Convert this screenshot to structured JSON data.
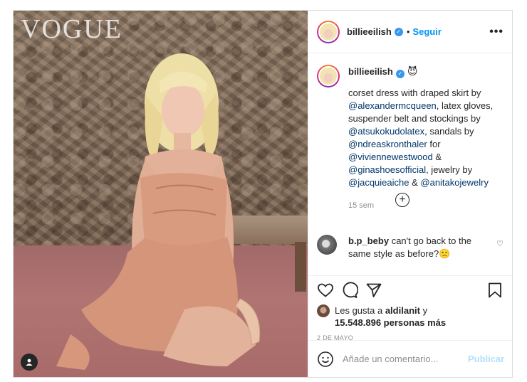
{
  "photo": {
    "masthead": "VOGUE"
  },
  "post": {
    "username": "billieeilish",
    "follow_label": "Seguir",
    "more_label": "•••",
    "caption_emoji": "😈",
    "caption": [
      {
        "t": "corset dress with draped skirt by ",
        "m": false
      },
      {
        "t": "@alexandermcqueen",
        "m": true
      },
      {
        "t": ", latex gloves, suspender belt and stockings by ",
        "m": false
      },
      {
        "t": "@atsukokudolatex",
        "m": true
      },
      {
        "t": ", sandals by ",
        "m": false
      },
      {
        "t": "@ndreaskronthaler",
        "m": true
      },
      {
        "t": " for ",
        "m": false
      },
      {
        "t": "@viviennewestwood",
        "m": true
      },
      {
        "t": " & ",
        "m": false
      },
      {
        "t": "@ginashoesofficial",
        "m": true
      },
      {
        "t": ", jewelry by ",
        "m": false
      },
      {
        "t": "@jacquieaiche",
        "m": true
      },
      {
        "t": " & ",
        "m": false
      },
      {
        "t": "@anitakojewelry",
        "m": true
      }
    ],
    "time_ago": "15 sem",
    "load_more_label": "+",
    "comment": {
      "username": "b.p_beby",
      "text": "can't go back to the same style as before?🙁"
    },
    "likes": {
      "prefix": "Les gusta a ",
      "liker": "aldilanit",
      "middle": " y",
      "count_text": "15.548.896 personas más"
    },
    "date": "2 DE MAYO",
    "add_comment": {
      "placeholder": "Añade un comentario...",
      "post_label": "Publicar"
    }
  },
  "colors": {
    "accent": "#0095f6",
    "verified": "#3897f0",
    "mention": "#00376b"
  }
}
